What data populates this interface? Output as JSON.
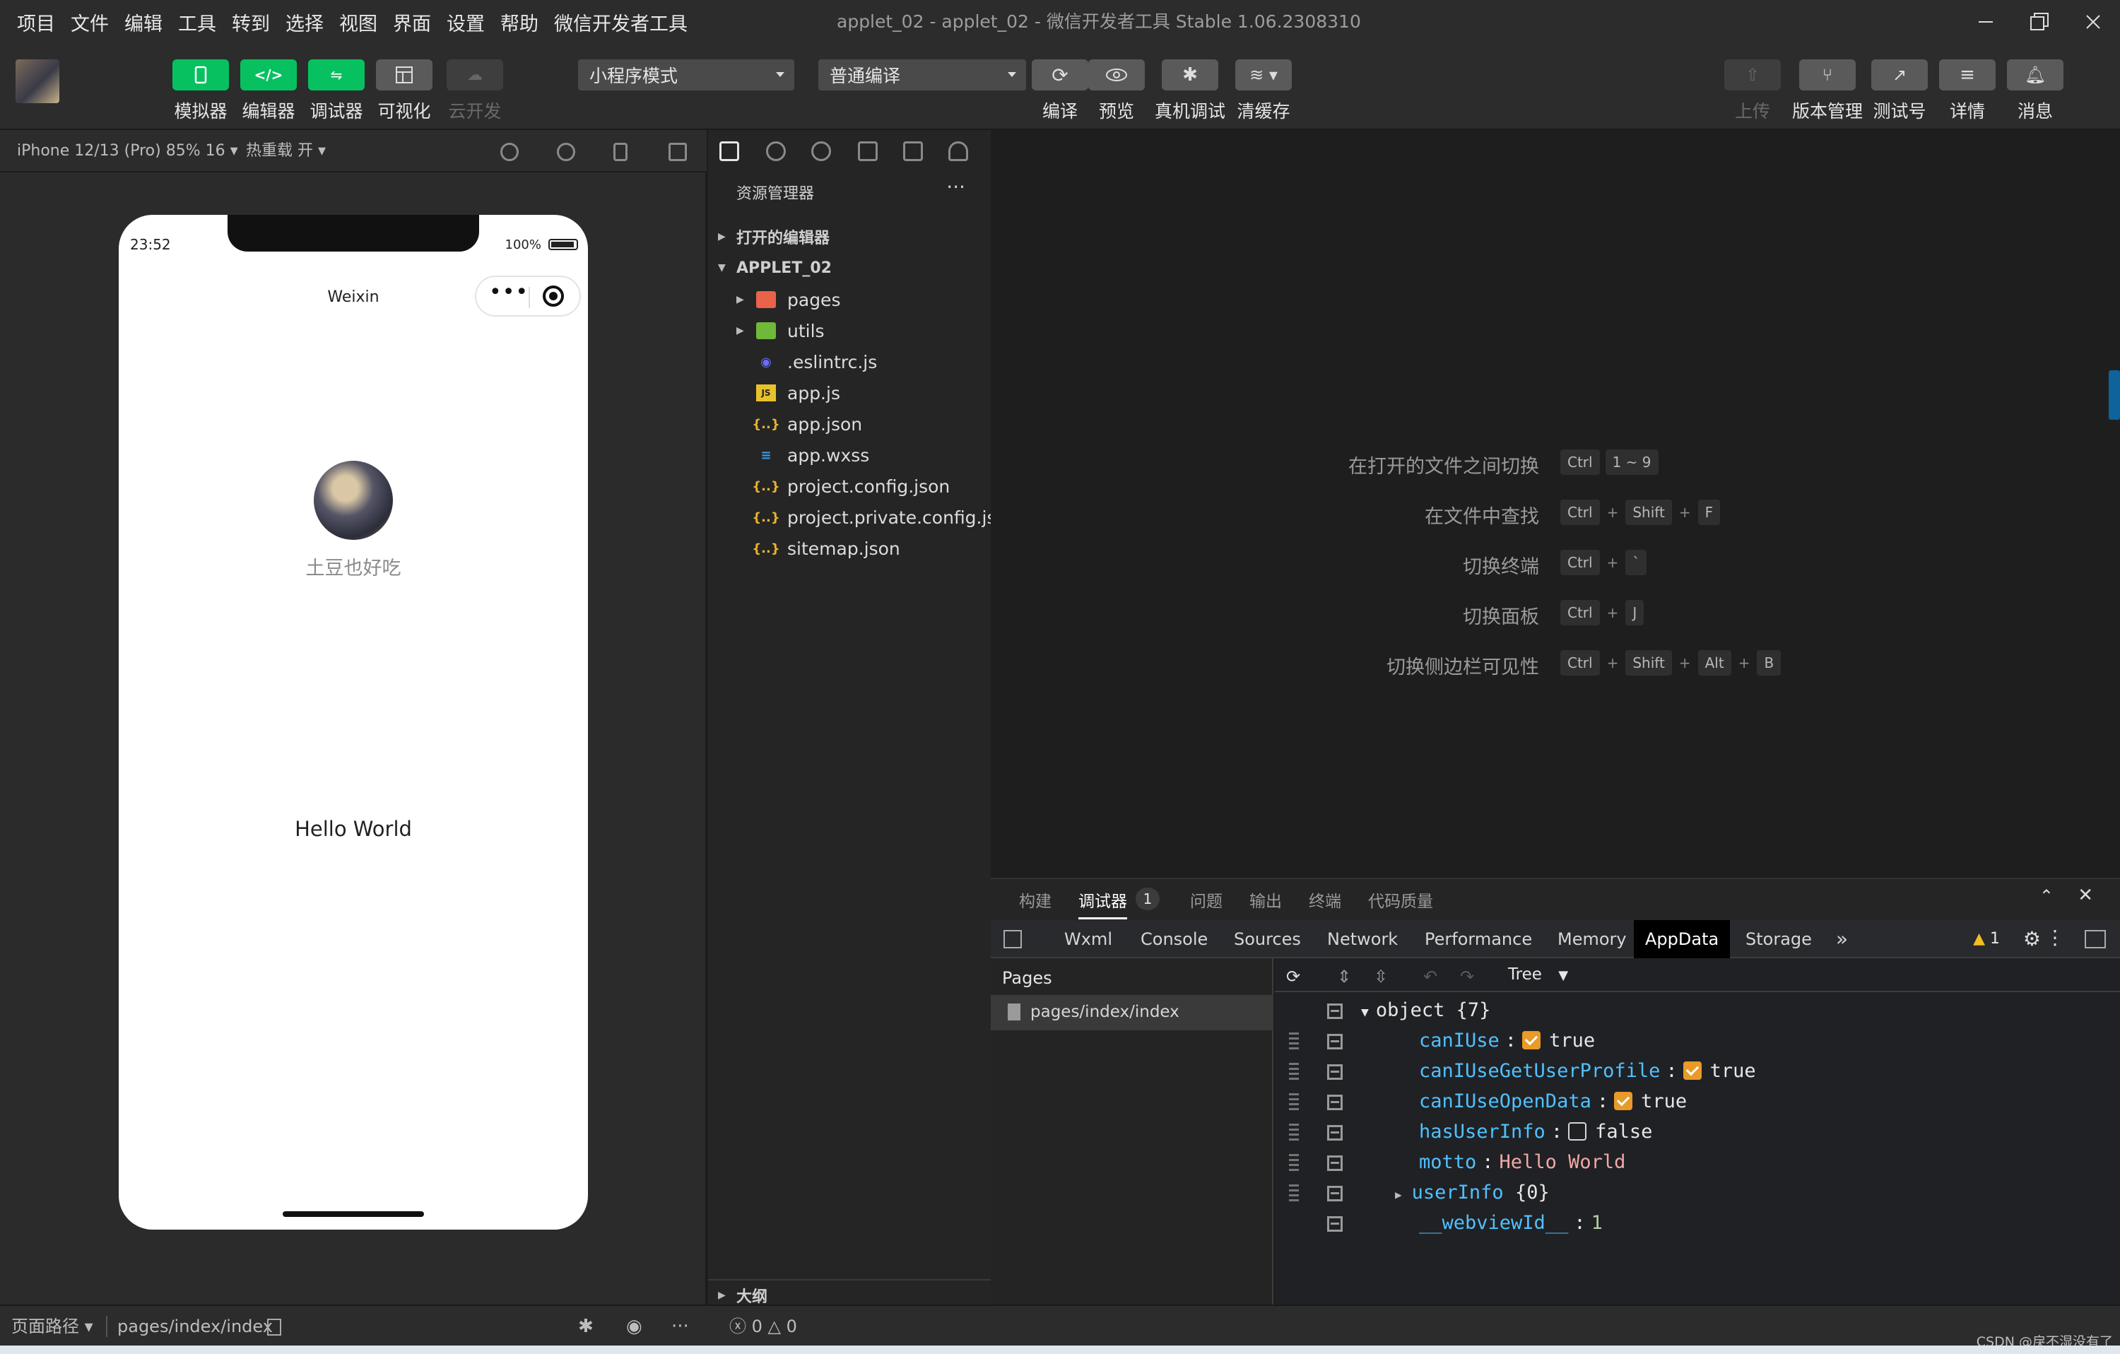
{
  "menu": [
    "项目",
    "文件",
    "编辑",
    "工具",
    "转到",
    "选择",
    "视图",
    "界面",
    "设置",
    "帮助",
    "微信开发者工具"
  ],
  "window_title": "applet_02 - applet_02 - 微信开发者工具 Stable 1.06.2308310",
  "toolbar": {
    "simulator": "模拟器",
    "editor": "编辑器",
    "debugger": "调试器",
    "visualize": "可视化",
    "cloud": "云开发",
    "mode_select": "小程序模式",
    "compile_select": "普通编译",
    "compile": "编译",
    "preview": "预览",
    "remote_debug": "真机调试",
    "clear_cache": "清缓存",
    "upload": "上传",
    "version": "版本管理",
    "test_account": "测试号",
    "details": "详情",
    "messages": "消息"
  },
  "simbar": {
    "device": "iPhone 12/13 (Pro) 85% 16 ▾",
    "hot_reload": "热重载 开 ▾"
  },
  "phone": {
    "time": "23:52",
    "battery": "100%",
    "nav_title": "Weixin",
    "capsule_dots": "•••",
    "nickname": "土豆也好吃",
    "motto": "Hello World"
  },
  "explorer": {
    "header": "资源管理器",
    "more": "···",
    "open_editors": "打开的编辑器",
    "project": "APPLET_02",
    "files": [
      {
        "name": "pages",
        "icon": "folder-icon"
      },
      {
        "name": "utils",
        "icon": "folder-icon"
      },
      {
        "name": ".eslintrc.js",
        "icon": "eslint-icon"
      },
      {
        "name": "app.js",
        "icon": "js-icon"
      },
      {
        "name": "app.json",
        "icon": "json-icon"
      },
      {
        "name": "app.wxss",
        "icon": "css-icon"
      },
      {
        "name": "project.config.json",
        "icon": "json-icon"
      },
      {
        "name": "project.private.config.js...",
        "icon": "json-icon"
      },
      {
        "name": "sitemap.json",
        "icon": "json-icon"
      }
    ],
    "outline": "大纲"
  },
  "shortcuts": [
    {
      "label": "在打开的文件之间切换",
      "keys": [
        "Ctrl",
        "1 ~ 9"
      ],
      "joined": false
    },
    {
      "label": "在文件中查找",
      "keys": [
        "Ctrl",
        "Shift",
        "F"
      ],
      "joined": true
    },
    {
      "label": "切换终端",
      "keys": [
        "Ctrl",
        "`"
      ],
      "joined": true
    },
    {
      "label": "切换面板",
      "keys": [
        "Ctrl",
        "J"
      ],
      "joined": true
    },
    {
      "label": "切换侧边栏可见性",
      "keys": [
        "Ctrl",
        "Shift",
        "Alt",
        "B"
      ],
      "joined": true
    }
  ],
  "panel": {
    "tabs": [
      "构建",
      "调试器",
      "问题",
      "输出",
      "终端",
      "代码质量"
    ],
    "badge": "1",
    "devtools_tabs": [
      "Wxml",
      "Console",
      "Sources",
      "Network",
      "Performance",
      "Memory",
      "AppData",
      "Storage"
    ],
    "more": "»",
    "warn": "1",
    "pages_header": "Pages",
    "page_item": "pages/index/index",
    "tree_mode": "Tree",
    "root": "object {7}",
    "data": [
      {
        "key": "canIUse",
        "type": "bool",
        "value": "true",
        "checked": true
      },
      {
        "key": "canIUseGetUserProfile",
        "type": "bool",
        "value": "true",
        "checked": true
      },
      {
        "key": "canIUseOpenData",
        "type": "bool",
        "value": "true",
        "checked": true
      },
      {
        "key": "hasUserInfo",
        "type": "bool",
        "value": "false",
        "checked": false
      },
      {
        "key": "motto",
        "type": "string",
        "value": "Hello World"
      },
      {
        "key": "userInfo",
        "type": "object",
        "value": "{0}"
      },
      {
        "key": "__webviewId__",
        "type": "number",
        "value": "1"
      }
    ]
  },
  "status": {
    "page_path_label": "页面路径 ▾",
    "page_path": "pages/index/index",
    "errors": "ⓧ 0 △ 0",
    "watermark": "CSDN @戾不湿没有了"
  },
  "colors": {
    "accent_green": "#07c160",
    "checkbox": "#e89b28",
    "key_blue": "#4fc1ff"
  }
}
